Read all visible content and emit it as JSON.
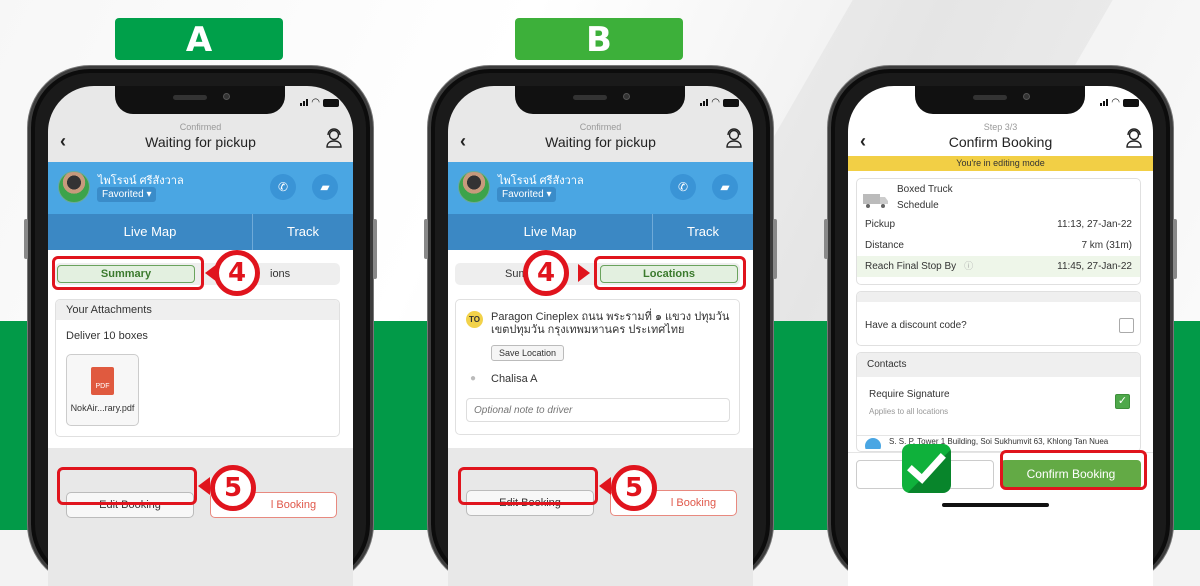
{
  "labels": {
    "a": "A",
    "b": "B"
  },
  "colors": {
    "label_a": "#00a04a",
    "label_b": "#3db03a",
    "band": "#029a48",
    "highlight": "#e0141d",
    "driver_bar": "#4aa6e3",
    "tab_bar": "#3b88c4",
    "edit_banner": "#f2cf45",
    "confirm_green": "#63aa45"
  },
  "phone_a": {
    "header": {
      "subtitle": "Confirmed",
      "title": "Waiting for pickup"
    },
    "driver": {
      "name": "ไพโรจน์ ศรีสังวาล",
      "favorited": "Favorited ▾"
    },
    "tabs": {
      "live_map": "Live Map",
      "track": "Track"
    },
    "segment": {
      "summary": "Summary",
      "locations_partial": "ions"
    },
    "attachments": {
      "header": "Your Attachments",
      "note": "Deliver 10 boxes",
      "file_name": "NokAir...rary.pdf",
      "file_type": "PDF"
    },
    "footer": {
      "edit": "Edit Booking",
      "cancel_partial": "l Booking"
    },
    "badges": {
      "step4": "4",
      "step5": "5"
    }
  },
  "phone_b": {
    "header": {
      "subtitle": "Confirmed",
      "title": "Waiting for pickup"
    },
    "driver": {
      "name": "ไพโรจน์ ศรีสังวาล",
      "favorited": "Favorited ▾"
    },
    "tabs": {
      "live_map": "Live Map",
      "track": "Track"
    },
    "segment": {
      "summary_partial": "Sum",
      "locations": "Locations"
    },
    "location": {
      "tag": "TO",
      "address": "Paragon Cineplex ถนน พระรามที่ ๑ แขวง ปทุมวัน เขตปทุมวัน กรุงเทพมหานคร ประเทศไทย",
      "save": "Save Location",
      "contact": "Chalisa A",
      "note_placeholder": "Optional note to driver"
    },
    "footer": {
      "edit": "Edit Booking",
      "cancel_partial": "l Booking"
    },
    "badges": {
      "step4": "4",
      "step5": "5"
    }
  },
  "phone_c": {
    "header": {
      "subtitle": "Step 3/3",
      "title": "Confirm Booking"
    },
    "banner": "You're in editing mode",
    "vehicle": {
      "type": "Boxed Truck",
      "mode": "Schedule"
    },
    "rows": [
      {
        "label": "Pickup",
        "value": "11:13, 27-Jan-22"
      },
      {
        "label": "Distance",
        "value": "7 km (31m)"
      },
      {
        "label": "Reach Final Stop By",
        "value": "11:45, 27-Jan-22"
      }
    ],
    "discount": "Have a discount code?",
    "contacts": {
      "header": "Contacts",
      "signature": "Require Signature",
      "signature_sub": "Applies to all locations",
      "address_partial": "S. S. P. Tower 1 Building, Soi Sukhumvit 63, Khlong Tan Nuea"
    },
    "footer": {
      "confirm": "Confirm Booking"
    }
  }
}
